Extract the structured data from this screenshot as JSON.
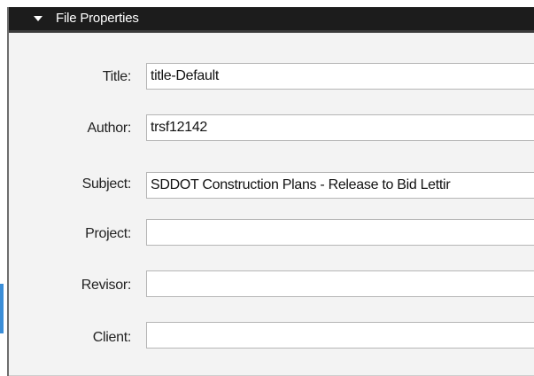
{
  "panel": {
    "title": "File Properties",
    "collapse_icon": "triangle-down-icon"
  },
  "fields": [
    {
      "label": "Title:",
      "value": "title-Default"
    },
    {
      "label": "Author:",
      "value": "trsf12142"
    },
    {
      "label": "Subject:",
      "value": "SDDOT Construction Plans - Release to Bid Lettir"
    },
    {
      "label": "Project:",
      "value": ""
    },
    {
      "label": "Revisor:",
      "value": ""
    },
    {
      "label": "Client:",
      "value": ""
    }
  ],
  "colors": {
    "header_bg": "#1c1c1c",
    "panel_bg": "#f3f3f3",
    "accent": "#3b8ed8"
  }
}
